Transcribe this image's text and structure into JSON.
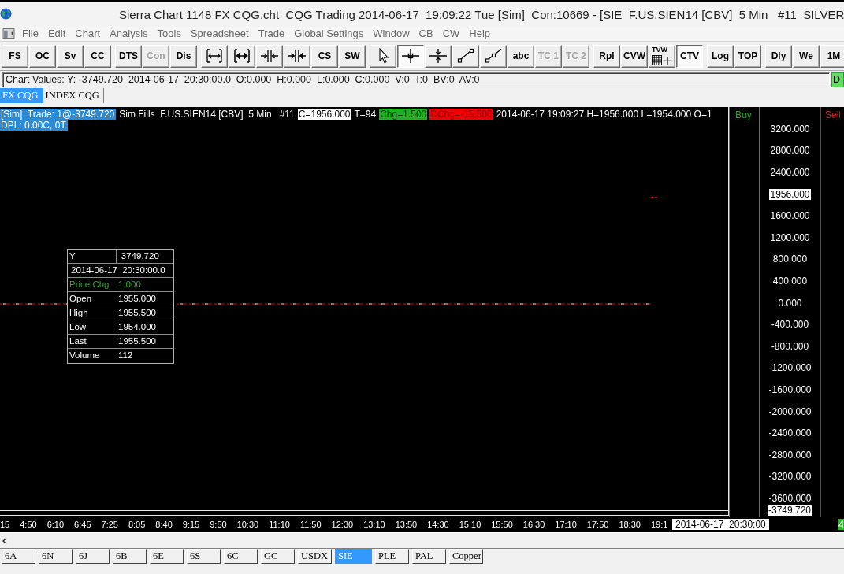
{
  "window": {
    "title": "Sierra Chart 1148 FX CQG.cht  CQG Trading 2014-06-17  19:09:22 Tue [Sim]  Con:10669 - [SIE  F.US.SIEN14 [CBV]  5 Min   #11  SILVER"
  },
  "menu": {
    "items": [
      {
        "label": "File"
      },
      {
        "label": "Edit"
      },
      {
        "label": "Chart"
      },
      {
        "label": "Analysis"
      },
      {
        "label": "Tools"
      },
      {
        "label": "Spreadsheet"
      },
      {
        "label": "Trade"
      },
      {
        "label": "Global Settings"
      },
      {
        "label": "Window"
      },
      {
        "label": "CB"
      },
      {
        "label": "CW"
      },
      {
        "label": "Help"
      }
    ]
  },
  "toolbar": {
    "groups": [
      {
        "buttons": [
          {
            "kind": "text",
            "label": "FS",
            "disabled": false,
            "selected": false
          },
          {
            "kind": "text",
            "label": "OC",
            "disabled": false,
            "selected": false
          },
          {
            "kind": "text",
            "label": "Sv",
            "disabled": false,
            "selected": false
          },
          {
            "kind": "text",
            "label": "CC",
            "disabled": false,
            "selected": false
          }
        ]
      },
      {
        "buttons": [
          {
            "kind": "text",
            "label": "DTS",
            "disabled": false,
            "selected": false
          },
          {
            "kind": "text",
            "label": "Con",
            "disabled": true,
            "selected": false
          },
          {
            "kind": "text",
            "label": "Dis",
            "disabled": false,
            "selected": false
          }
        ]
      },
      {
        "buttons": [
          {
            "kind": "icon",
            "disabled": false,
            "selected": false
          },
          {
            "kind": "icon",
            "disabled": false,
            "selected": false
          },
          {
            "kind": "icon",
            "disabled": false,
            "selected": false
          },
          {
            "kind": "icon",
            "disabled": false,
            "selected": false
          },
          {
            "kind": "text",
            "label": "CS",
            "disabled": false,
            "selected": false
          },
          {
            "kind": "text",
            "label": "SW",
            "disabled": false,
            "selected": false
          }
        ]
      },
      {
        "buttons": [
          {
            "kind": "icon",
            "disabled": false,
            "selected": false
          },
          {
            "kind": "icon",
            "disabled": false,
            "selected": true
          },
          {
            "kind": "icon",
            "disabled": false,
            "selected": false
          },
          {
            "kind": "icon",
            "disabled": false,
            "selected": false
          },
          {
            "kind": "icon",
            "disabled": false,
            "selected": false
          },
          {
            "kind": "text",
            "label": "abc",
            "disabled": false,
            "selected": false
          },
          {
            "kind": "text",
            "label": "TC 1",
            "disabled": true,
            "selected": false
          },
          {
            "kind": "text",
            "label": "TC 2",
            "disabled": true,
            "selected": false
          }
        ]
      },
      {
        "buttons": [
          {
            "kind": "text",
            "label": "Rpl",
            "disabled": false,
            "selected": false
          },
          {
            "kind": "text",
            "label": "CVW",
            "disabled": false,
            "selected": false
          },
          {
            "kind": "icon",
            "label": "TVW",
            "disabled": false,
            "selected": false
          },
          {
            "kind": "text",
            "label": "CTV",
            "disabled": false,
            "selected": true
          }
        ]
      },
      {
        "buttons": [
          {
            "kind": "text",
            "label": "Log",
            "disabled": false,
            "selected": false
          },
          {
            "kind": "text",
            "label": "TOP",
            "disabled": false,
            "selected": false
          }
        ]
      },
      {
        "buttons": [
          {
            "kind": "text",
            "label": "Dly",
            "disabled": false,
            "selected": false
          },
          {
            "kind": "text",
            "label": "We",
            "disabled": false,
            "selected": false
          },
          {
            "kind": "text",
            "label": "1M",
            "disabled": false,
            "selected": false
          }
        ]
      }
    ]
  },
  "chart_values": {
    "text": "Chart Values: Y: -3749.720  2014-06-17  20:30:00.0  O:0.000  H:0.000  L:0.000  C:0.000  V:0  T:0  BV:0  AV:0",
    "indicator": "D"
  },
  "chartbook_tabs": [
    {
      "label": "FX CQG",
      "selected": true
    },
    {
      "label": "INDEX CQG",
      "selected": false
    }
  ],
  "chart": {
    "header_lines": [
      [
        {
          "kind": "blue",
          "text": "[Sim]  Trade: 1@-3749.720"
        },
        {
          "kind": "plain",
          "text": "Sim Fills  F.US.SIEN14 [CBV]  5 Min   #11"
        },
        {
          "kind": "white",
          "text": "C=1956.000"
        },
        {
          "kind": "plain",
          "text": "T=94"
        },
        {
          "kind": "green",
          "text": "Chg=1.500"
        },
        {
          "kind": "red",
          "text": "DChg=-15.500"
        },
        {
          "kind": "plain",
          "text": "2014-06-17 19:09:27 H=1956.000 L=1954.000 O=1"
        }
      ],
      [
        {
          "kind": "blue",
          "text": "DPL: 0.00C, 0T"
        }
      ]
    ],
    "data_window": {
      "rows": [
        {
          "kind": "pair",
          "label": "Y",
          "value": "-3749.720"
        },
        {
          "kind": "span",
          "value": "2014-06-17  20:30:00.0"
        },
        {
          "kind": "pair",
          "label": "Price Chg",
          "value": "1.000",
          "color": "#2fa12f"
        },
        {
          "kind": "pair",
          "label": "Open",
          "value": "1955.000"
        },
        {
          "kind": "pair",
          "label": "High",
          "value": "1955.500"
        },
        {
          "kind": "pair",
          "label": "Low",
          "value": "1954.000"
        },
        {
          "kind": "pair",
          "label": "Last",
          "value": "1955.500"
        },
        {
          "kind": "pair",
          "label": "Volume",
          "value": "112"
        }
      ]
    },
    "buy_label": "Buy",
    "sell_label": "Sell",
    "price_scale": [
      {
        "kind": "tick",
        "text": "3200.000"
      },
      {
        "kind": "tick",
        "text": "2800.000"
      },
      {
        "kind": "tick",
        "text": "2400.000"
      },
      {
        "kind": "marker",
        "text": "1956.000"
      },
      {
        "kind": "tick",
        "text": "1600.000"
      },
      {
        "kind": "tick",
        "text": "1200.000"
      },
      {
        "kind": "tick",
        "text": "800.000"
      },
      {
        "kind": "tick",
        "text": "400.000"
      },
      {
        "kind": "tick",
        "text": "0.000"
      },
      {
        "kind": "tick",
        "text": "-400.000"
      },
      {
        "kind": "tick",
        "text": "-800.000"
      },
      {
        "kind": "tick",
        "text": "-1200.000"
      },
      {
        "kind": "tick",
        "text": "-1600.000"
      },
      {
        "kind": "tick",
        "text": "-2000.000"
      },
      {
        "kind": "tick",
        "text": "-2400.000"
      },
      {
        "kind": "tick",
        "text": "-2800.000"
      },
      {
        "kind": "tick",
        "text": "-3200.000"
      },
      {
        "kind": "tick",
        "text": "-3600.000"
      }
    ],
    "cursor_price": "-3749.720",
    "time_scale": [
      "15",
      "4:50",
      "6:10",
      "6:45",
      "7:25",
      "8:05",
      "8:40",
      "9:15",
      "9:50",
      "10:30",
      "11:10",
      "11:50",
      "12:30",
      "13:10",
      "13:50",
      "14:30",
      "15:10",
      "15:50",
      "16:30",
      "17:10",
      "17:50",
      "18:30",
      "19:1"
    ],
    "cursor_time": "2014-06-17  20:30:00"
  },
  "chart_tabs": [
    {
      "label": "6A",
      "selected": false
    },
    {
      "label": "6N",
      "selected": false
    },
    {
      "label": "6J",
      "selected": false
    },
    {
      "label": "6B",
      "selected": false
    },
    {
      "label": "6E",
      "selected": false
    },
    {
      "label": "6S",
      "selected": false
    },
    {
      "label": "6C",
      "selected": false
    },
    {
      "label": "GC",
      "selected": false
    },
    {
      "label": "USDX",
      "selected": false
    },
    {
      "label": "SIE",
      "selected": true
    },
    {
      "label": "PLE",
      "selected": false
    },
    {
      "label": "PAL",
      "selected": false
    },
    {
      "label": "Copper",
      "selected": false
    }
  ]
}
